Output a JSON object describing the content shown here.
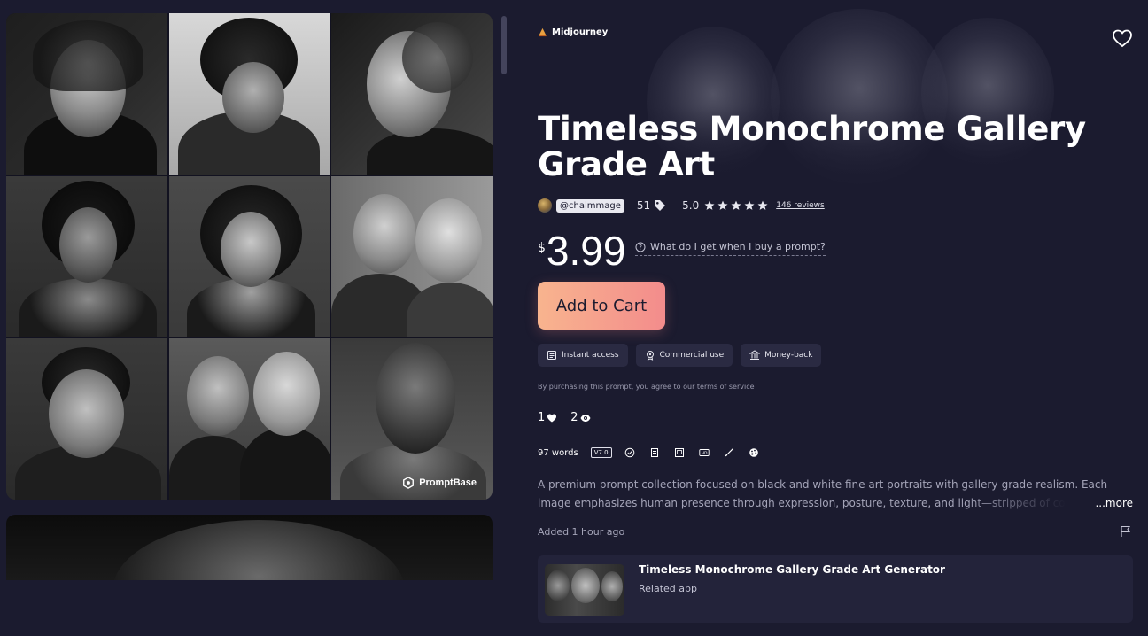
{
  "gallery": {
    "watermark": "PromptBase"
  },
  "product": {
    "platform": "Midjourney",
    "title": "Timeless Monochrome Gallery Grade Art",
    "seller_handle": "@chaimmage",
    "tag_count": "51",
    "rating": "5.0",
    "stars": 5,
    "reviews": "146 reviews",
    "currency": "$",
    "price": "3.99",
    "what_do_i_get": "What do I get when I buy a prompt?",
    "add_to_cart": "Add to Cart",
    "perks": [
      "Instant access",
      "Commercial use",
      "Money-back"
    ],
    "terms": "By purchasing this prompt, you agree to our terms of service",
    "likes": "1",
    "views": "2",
    "words": "97 words",
    "version": "V7.0",
    "feature_icons": [
      "check-badge-icon",
      "document-icon",
      "picture-icon",
      "hd-icon",
      "brush-icon",
      "palette-icon"
    ],
    "description": "A premium prompt collection focused on black and white fine art portraits with gallery-grade realism. Each image emphasizes human presence through expression, posture, texture, and light—stripped of color to reveal em",
    "more_label": "...more",
    "added": "Added 1 hour ago"
  },
  "related": {
    "title": "Timeless Monochrome Gallery Grade Art Generator",
    "subtitle": "Related app"
  },
  "colors": {
    "background": "#1b1b2f",
    "cart_gradient_start": "#f8b48e",
    "cart_gradient_end": "#f38c8c",
    "chip_bg": "#2a2a42",
    "card_bg": "#23233a"
  }
}
